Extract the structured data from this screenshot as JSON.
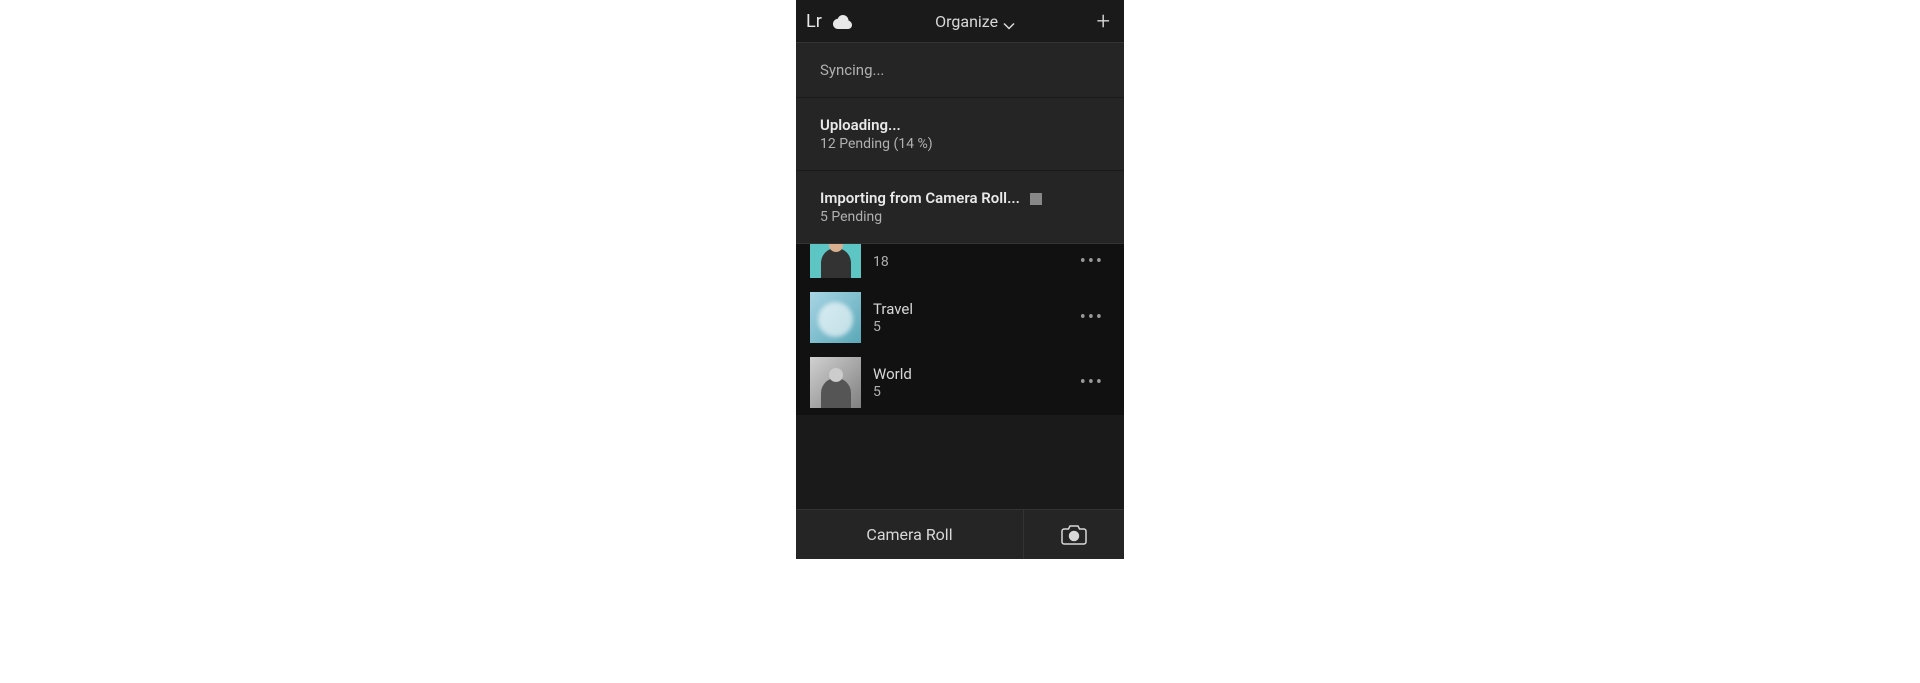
{
  "header": {
    "logo": "Lr",
    "title": "Organize"
  },
  "status": {
    "syncing": "Syncing...",
    "uploading": {
      "title": "Uploading...",
      "sub": "12 Pending  (14 %)"
    },
    "importing": {
      "title": "Importing from Camera Roll...",
      "sub": "5 Pending"
    }
  },
  "albums": [
    {
      "name": "",
      "count": "18"
    },
    {
      "name": "Travel",
      "count": "5"
    },
    {
      "name": "World",
      "count": "5"
    }
  ],
  "bottomBar": {
    "cameraRoll": "Camera Roll"
  }
}
